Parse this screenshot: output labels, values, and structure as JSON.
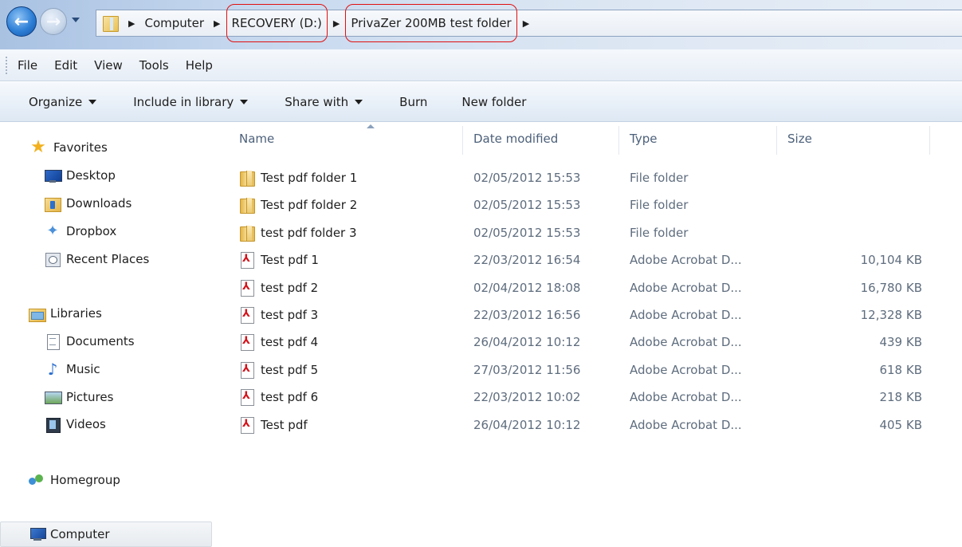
{
  "address_bar": {
    "back_icon": "back-arrow-icon",
    "forward_icon": "forward-arrow-icon",
    "crumbs": [
      "Computer",
      "RECOVERY (D:)",
      "PrivaZer 200MB test folder"
    ],
    "highlight_color": "#e01010"
  },
  "menu": {
    "items": [
      "File",
      "Edit",
      "View",
      "Tools",
      "Help"
    ]
  },
  "toolbar": {
    "organize": "Organize",
    "include_in_library": "Include in library",
    "share_with": "Share with",
    "burn": "Burn",
    "new_folder": "New folder"
  },
  "navigation": {
    "favorites": {
      "label": "Favorites",
      "items": [
        "Desktop",
        "Downloads",
        "Dropbox",
        "Recent Places"
      ]
    },
    "libraries": {
      "label": "Libraries",
      "items": [
        "Documents",
        "Music",
        "Pictures",
        "Videos"
      ]
    },
    "homegroup": "Homegroup",
    "computer": "Computer"
  },
  "file_list": {
    "columns": {
      "name": "Name",
      "date_modified": "Date modified",
      "type": "Type",
      "size": "Size"
    },
    "sort_column": "name",
    "rows": [
      {
        "icon": "folder-icon",
        "name": "Test pdf folder 1",
        "date": "02/05/2012 15:53",
        "type": "File folder",
        "size": ""
      },
      {
        "icon": "folder-icon",
        "name": "Test pdf folder 2",
        "date": "02/05/2012 15:53",
        "type": "File folder",
        "size": ""
      },
      {
        "icon": "folder-icon",
        "name": "test pdf folder 3",
        "date": "02/05/2012 15:53",
        "type": "File folder",
        "size": ""
      },
      {
        "icon": "pdf-icon",
        "name": "Test pdf 1",
        "date": "22/03/2012 16:54",
        "type": "Adobe Acrobat D...",
        "size": "10,104 KB"
      },
      {
        "icon": "pdf-icon",
        "name": "test pdf 2",
        "date": "02/04/2012 18:08",
        "type": "Adobe Acrobat D...",
        "size": "16,780 KB"
      },
      {
        "icon": "pdf-icon",
        "name": "test pdf 3",
        "date": "22/03/2012 16:56",
        "type": "Adobe Acrobat D...",
        "size": "12,328 KB"
      },
      {
        "icon": "pdf-icon",
        "name": "test pdf 4",
        "date": "26/04/2012 10:12",
        "type": "Adobe Acrobat D...",
        "size": "439 KB"
      },
      {
        "icon": "pdf-icon",
        "name": "test pdf 5",
        "date": "27/03/2012 11:56",
        "type": "Adobe Acrobat D...",
        "size": "618 KB"
      },
      {
        "icon": "pdf-icon",
        "name": "test pdf 6",
        "date": "22/03/2012 10:02",
        "type": "Adobe Acrobat D...",
        "size": "218 KB"
      },
      {
        "icon": "pdf-icon",
        "name": "Test pdf",
        "date": "26/04/2012 10:12",
        "type": "Adobe Acrobat D...",
        "size": "405 KB"
      }
    ]
  }
}
